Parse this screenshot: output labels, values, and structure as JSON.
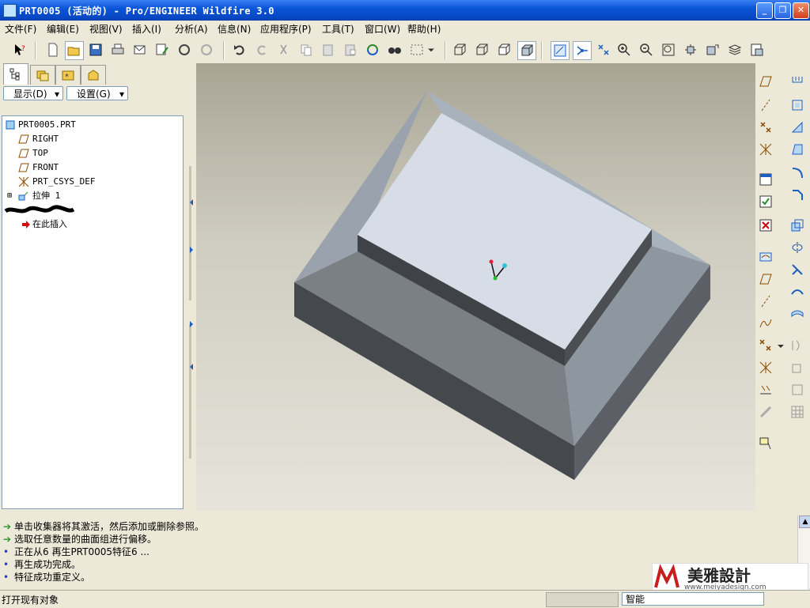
{
  "window": {
    "title": "PRT0005 (活动的) - Pro/ENGINEER Wildfire 3.0"
  },
  "menu": [
    "文件(F)",
    "编辑(E)",
    "视图(V)",
    "插入(I)",
    "分析(A)",
    "信息(N)",
    "应用程序(P)",
    "工具(T)",
    "窗口(W)",
    "帮助(H)"
  ],
  "left_panel": {
    "show_button": "显示(D)",
    "settings_button": "设置(G)",
    "tree": [
      {
        "label": "PRT0005.PRT",
        "icon": "part-icon"
      },
      {
        "label": "RIGHT",
        "icon": "datum-plane-icon"
      },
      {
        "label": "TOP",
        "icon": "datum-plane-icon"
      },
      {
        "label": "FRONT",
        "icon": "datum-plane-icon"
      },
      {
        "label": "PRT_CSYS_DEF",
        "icon": "csys-icon"
      },
      {
        "label": "拉伸 1",
        "icon": "extrude-icon"
      },
      {
        "label": "在此插入",
        "icon": "insert-here-arrow-icon"
      }
    ]
  },
  "messages": [
    {
      "icon": "green-arrow",
      "text": "单击收集器将其激活，然后添加或删除参照。"
    },
    {
      "icon": "green-arrow",
      "text": "选取任意数量的曲面组进行偏移。"
    },
    {
      "icon": "blue-dot",
      "text": "正在从6 再生PRT0005特征6 ..."
    },
    {
      "icon": "blue-dot",
      "text": "再生成功完成。"
    },
    {
      "icon": "blue-dot",
      "text": "特征成功重定义。"
    }
  ],
  "status": {
    "text": "打开现有对象",
    "filter_value": "智能"
  },
  "watermark": {
    "logo_text": "美雅設計",
    "url": "www.meiyadesign.com"
  },
  "colors": {
    "titlebar": "#0a55d8",
    "viewport_bg": "#c9c6b8",
    "model_top": "#d6dde6",
    "model_side": "#5c6066"
  }
}
